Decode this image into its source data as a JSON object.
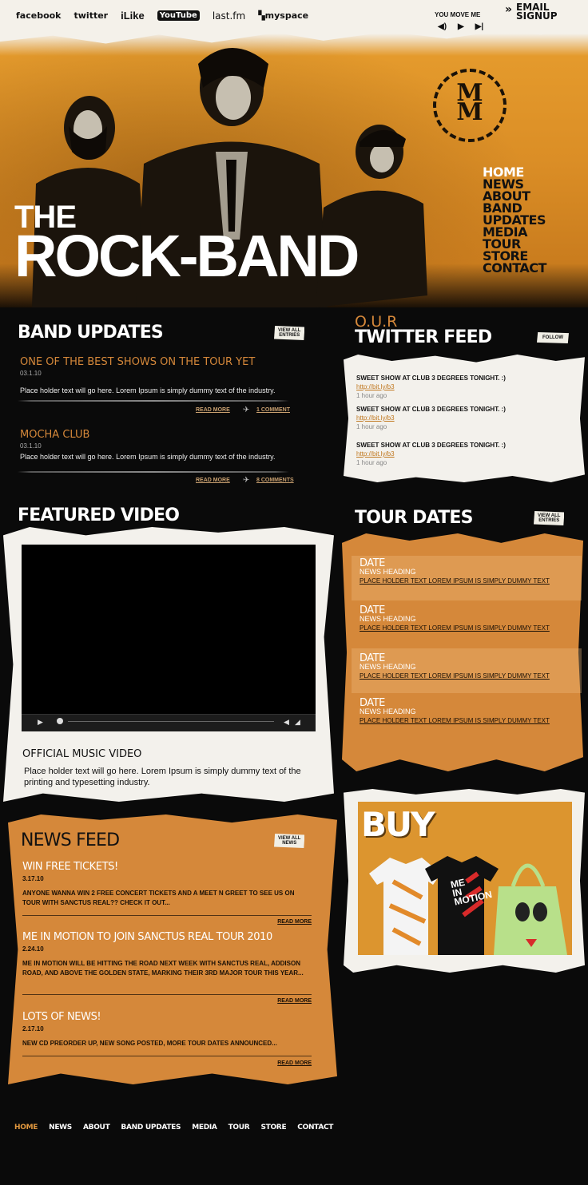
{
  "social": [
    "facebook",
    "twitter",
    "iLike",
    "YouTube",
    "last.fm",
    "myspace"
  ],
  "player": {
    "label": "YOU MOVE ME"
  },
  "email_signup": [
    "EMAIL",
    "SIGNUP"
  ],
  "logo": [
    "M",
    "M"
  ],
  "nav": [
    "HOME",
    "NEWS",
    "ABOUT",
    "BAND UPDATES",
    "MEDIA",
    "TOUR",
    "STORE",
    "CONTACT"
  ],
  "title": {
    "line1": "THE",
    "line2": "ROCK-BAND"
  },
  "band_updates": {
    "title": "BAND UPDATES",
    "view_all": [
      "VIEW ALL",
      "ENTRIES"
    ],
    "items": [
      {
        "title": "ONE OF THE BEST SHOWS ON THE TOUR YET",
        "date": "03.1.10",
        "text": "Place holder text will go here. Lorem Ipsum is simply dummy text of the industry.",
        "read_more": "READ MORE",
        "comments": "1 COMMENT"
      },
      {
        "title": "MOCHA CLUB",
        "date": "03.1.10",
        "text": "Place holder text will go here. Lorem Ipsum is simply dummy text of the industry.",
        "read_more": "READ MORE",
        "comments": "8 COMMENTS"
      }
    ]
  },
  "twitter": {
    "prefix": "O.U.R",
    "title": "TWITTER FEED",
    "follow": "FOLLOW",
    "tweets": [
      {
        "text": "SWEET SHOW AT CLUB 3 DEGREES TONIGHT. :)",
        "link": "http://bit.ly/b3",
        "ago": "1 hour ago"
      },
      {
        "text": "SWEET SHOW AT CLUB 3 DEGREES TONIGHT. :)",
        "link": "http://bit.ly/b3",
        "ago": "1 hour ago"
      },
      {
        "text": "SWEET SHOW AT CLUB 3 DEGREES TONIGHT. :)",
        "link": "http://bit.ly/b3",
        "ago": "1 hour ago"
      }
    ]
  },
  "video": {
    "section_title": "FEATURED VIDEO",
    "title": "OFFICIAL MUSIC VIDEO",
    "text": "Place holder text will go here. Lorem Ipsum is simply dummy text of the printing and typesetting industry."
  },
  "tour": {
    "title": "TOUR DATES",
    "view_all": [
      "VIEW ALL",
      "ENTRIES"
    ],
    "items": [
      {
        "date": "DATE",
        "heading": "NEWS HEADING",
        "text": "PLACE HOLDER TEXT LOREM IPSUM IS SIMPLY DUMMY TEXT"
      },
      {
        "date": "DATE",
        "heading": "NEWS HEADING",
        "text": "PLACE HOLDER TEXT LOREM IPSUM IS SIMPLY DUMMY TEXT"
      },
      {
        "date": "DATE",
        "heading": "NEWS HEADING",
        "text": "PLACE HOLDER TEXT LOREM IPSUM IS SIMPLY DUMMY TEXT"
      },
      {
        "date": "DATE",
        "heading": "NEWS HEADING",
        "text": "PLACE HOLDER TEXT LOREM IPSUM IS SIMPLY DUMMY TEXT"
      }
    ]
  },
  "buy": {
    "label": "BUY",
    "shirt_text": [
      "ME",
      "IN",
      "MOTION"
    ]
  },
  "news": {
    "title": "NEWS FEED",
    "view_all": [
      "VIEW ALL",
      "NEWS"
    ],
    "items": [
      {
        "title": "WIN FREE TICKETS!",
        "date": "3.17.10",
        "text": "Anyone wanna win 2 free concert tickets and a meet n greet to see us on tour with Sanctus Real?? Check it out...",
        "more": "READ MORE"
      },
      {
        "title": "ME IN MOTION TO JOIN SANCTUS REAL TOUR 2010",
        "date": "2.24.10",
        "text": "Me in Motion will be hitting the road next week with Sanctus Real, Addison Road, and Above the Golden State, marking their 3rd major tour this year...",
        "more": "READ MORE"
      },
      {
        "title": "LOTS OF NEWS!",
        "date": "2.17.10",
        "text": "New CD preorder up, new song posted, more tour dates announced...",
        "more": "READ MORE"
      }
    ]
  },
  "footer": [
    "HOME",
    "NEWS",
    "ABOUT",
    "BAND UPDATES",
    "MEDIA",
    "TOUR",
    "STORE",
    "CONTACT"
  ],
  "colors": {
    "accent": "#d5883a",
    "background": "#0a0a0a",
    "paper": "#f3f1ec"
  }
}
